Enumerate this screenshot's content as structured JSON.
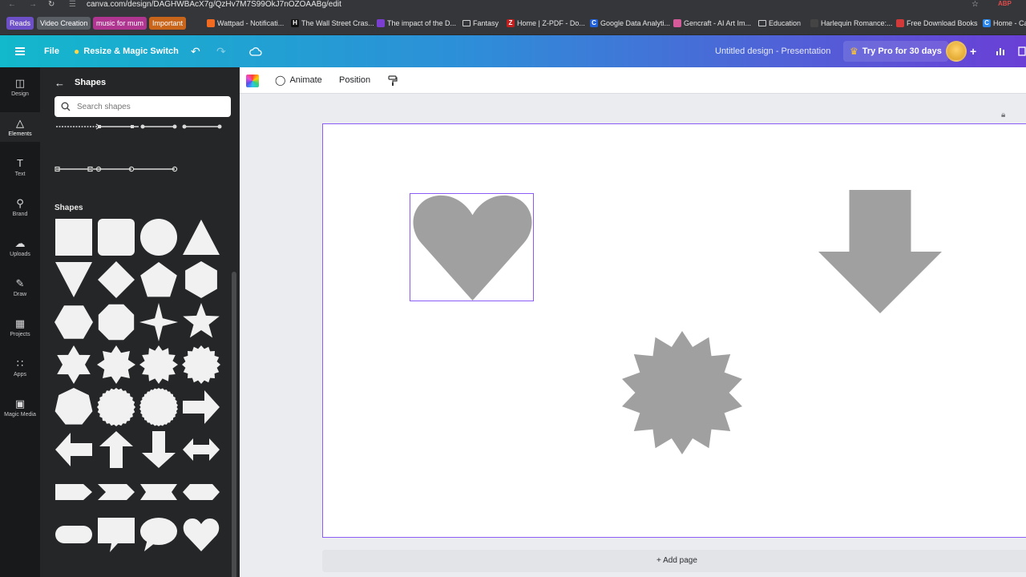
{
  "browser": {
    "url": "canva.com/design/DAGHWBAcX7g/QzHv7M7S99OkJ7nOZOAABg/edit",
    "bookmarks": [
      {
        "label": "Reads",
        "color": "#6d4fc7",
        "pill": true
      },
      {
        "label": "Video Creation",
        "color": "#5a5f66",
        "pill": true
      },
      {
        "label": "music for mum",
        "color": "#b03590",
        "pill": true
      },
      {
        "label": "Important",
        "color": "#c9651b",
        "pill": true
      },
      {
        "label": "Wattpad - Notificati...",
        "color": "#f26b21"
      },
      {
        "label": "The Wall Street Cras...",
        "color": "#111111",
        "glyph": "H"
      },
      {
        "label": "The impact of the D...",
        "color": "#7a3fd1"
      },
      {
        "label": "Fantasy",
        "color": "folder"
      },
      {
        "label": "Home | Z-PDF - Do...",
        "color": "#c31f1f",
        "glyph": "Z"
      },
      {
        "label": "Google Data Analyti...",
        "color": "#2060d9",
        "glyph": "C"
      },
      {
        "label": "Gencraft - AI Art Im...",
        "color": "#d45a9a"
      },
      {
        "label": "Education",
        "color": "folder"
      },
      {
        "label": "Harlequin Romance:...",
        "color": "#444444"
      },
      {
        "label": "Free Download Books",
        "color": "#d23a3a"
      },
      {
        "label": "Home - Ca",
        "color": "#2a86e8",
        "glyph": "C"
      }
    ]
  },
  "topbar": {
    "file_label": "File",
    "resize_label": "Resize & Magic Switch",
    "design_title": "Untitled design - Presentation",
    "try_pro_label": "Try Pro for 30 days"
  },
  "rail": {
    "items": [
      {
        "label": "Design",
        "icon": "layout-icon"
      },
      {
        "label": "Elements",
        "icon": "shapes-icon",
        "active": true
      },
      {
        "label": "Text",
        "icon": "text-icon"
      },
      {
        "label": "Brand",
        "icon": "brand-icon"
      },
      {
        "label": "Uploads",
        "icon": "upload-icon"
      },
      {
        "label": "Draw",
        "icon": "pen-icon"
      },
      {
        "label": "Projects",
        "icon": "folder-icon"
      },
      {
        "label": "Apps",
        "icon": "grid-icon"
      },
      {
        "label": "Magic Media",
        "icon": "magic-media-icon"
      }
    ]
  },
  "panel": {
    "title": "Shapes",
    "search_placeholder": "Search shapes",
    "shapes_heading": "Shapes",
    "shape_tiles": [
      "square",
      "rounded-square",
      "circle",
      "triangle",
      "inverted-triangle",
      "diamond",
      "pentagon",
      "hexagon",
      "hexagon-wide",
      "octagon",
      "four-point-star",
      "five-point-star",
      "six-point-star",
      "eight-point-star",
      "twelve-point-burst",
      "sixteen-point-burst",
      "heptagon",
      "scalloped-circle",
      "seal",
      "arrow-right",
      "arrow-left",
      "arrow-up",
      "arrow-down",
      "arrow-double",
      "pentagon-arrow",
      "chevron",
      "banner",
      "hexagon-flat",
      "pill",
      "speech-bubble-rect",
      "speech-bubble-round",
      "heart"
    ]
  },
  "toolbar": {
    "animate_label": "Animate",
    "position_label": "Position"
  },
  "canvas": {
    "shape_color": "#a0a0a0",
    "selection_color": "#8b5cf6",
    "elements": [
      "heart",
      "arrow-down",
      "starburst"
    ],
    "add_page_label": "+ Add page"
  }
}
